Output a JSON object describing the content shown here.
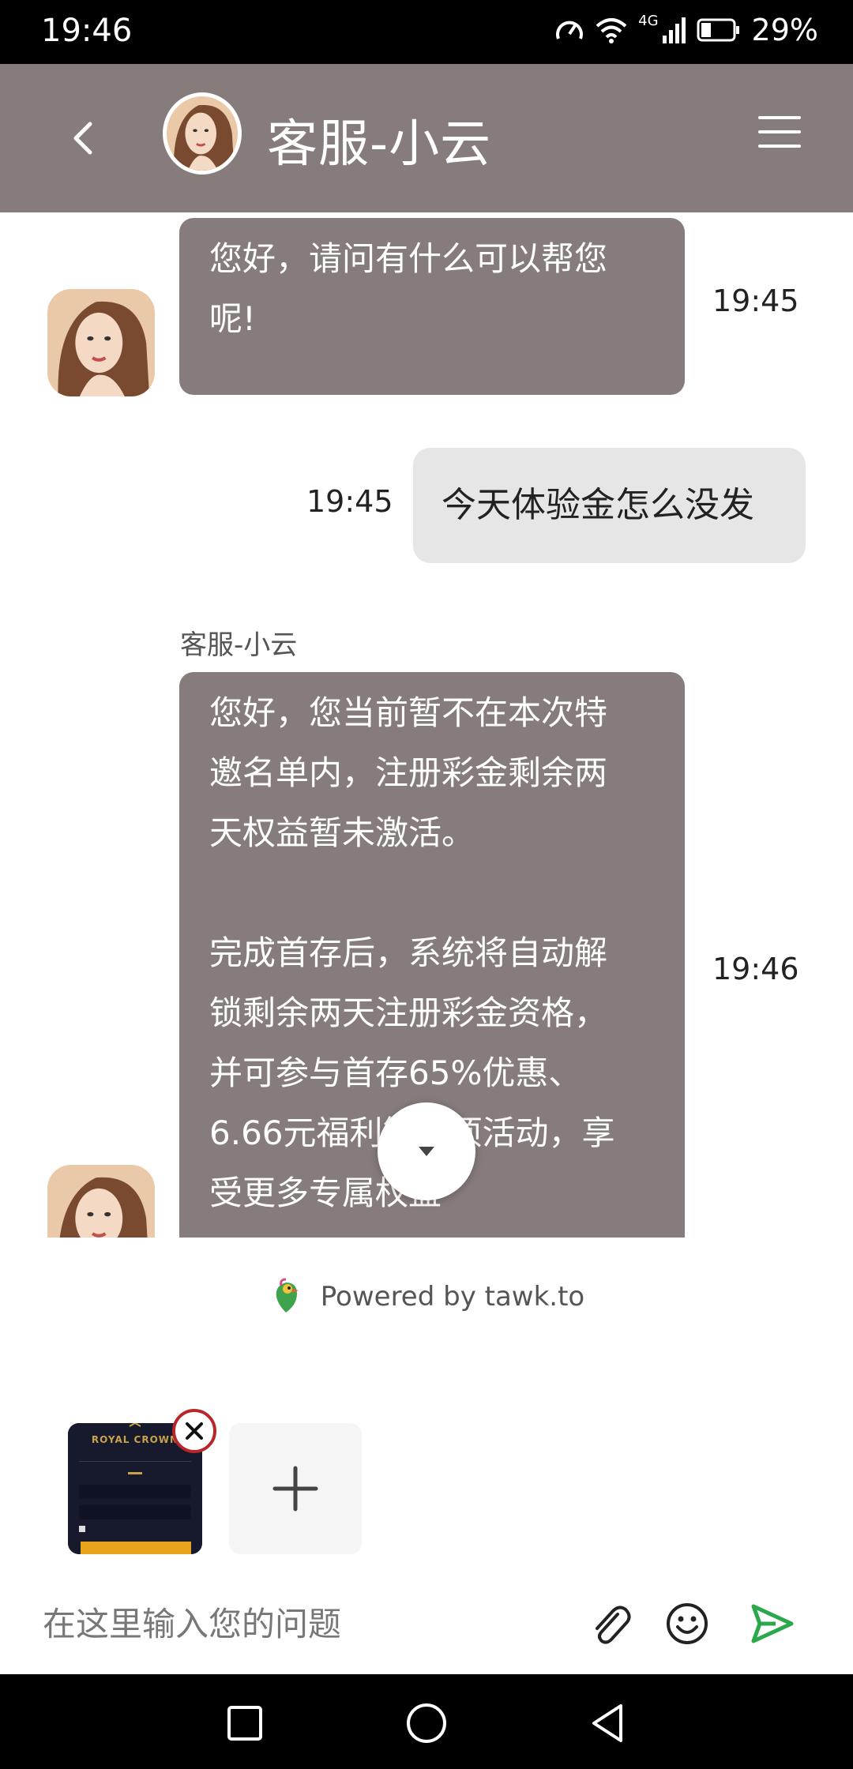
{
  "status_bar": {
    "time": "19:46",
    "network": "4G",
    "battery": "29%"
  },
  "header": {
    "title": "客服-小云"
  },
  "messages": [
    {
      "from": "agent",
      "text_lines": [
        "您好，请问有什么可以帮您",
        "呢!"
      ],
      "time": "19:45"
    },
    {
      "from": "user",
      "text": "今天体验金怎么没发",
      "time": "19:45"
    },
    {
      "from": "agent",
      "sender": "客服-小云",
      "text_lines": [
        "您好，您当前暂不在本次特",
        "邀名单内，注册彩金剩余两",
        "天权益暂未激活。",
        "",
        "完成首存后，系统将自动解",
        "锁剩余两天注册彩金资格，",
        "并可参与首存65%优惠、",
        "6.66元福利等多项活动，享",
        "受更多专属权益"
      ],
      "time": "19:46"
    }
  ],
  "powered_by": "Powered by tawk.to",
  "attachment": {
    "brand_text": "ROYAL CROWN"
  },
  "input": {
    "placeholder": "在这里输入您的问题"
  },
  "icons": {
    "back": "chevron-left-icon",
    "menu": "hamburger-icon",
    "scroll": "caret-down-icon",
    "attach": "paperclip-icon",
    "emoji": "smiley-icon",
    "send": "send-icon",
    "add": "plus-icon",
    "remove": "close-icon"
  },
  "colors": {
    "header": "#877c7c",
    "agent_bubble": "#877c7c",
    "user_bubble": "#e6e6e6",
    "send": "#2aa84a"
  }
}
